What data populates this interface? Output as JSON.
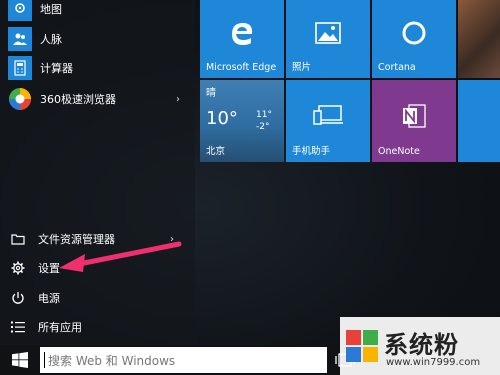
{
  "start_menu": {
    "apps": [
      {
        "label": "地图"
      },
      {
        "label": "人脉"
      },
      {
        "label": "计算器"
      },
      {
        "label": "360极速浏览器"
      }
    ],
    "bottom": [
      {
        "label": "文件资源管理器"
      },
      {
        "label": "设置"
      },
      {
        "label": "电源"
      },
      {
        "label": "所有应用"
      }
    ]
  },
  "tiles": {
    "edge": {
      "label": "Microsoft Edge"
    },
    "photos": {
      "label": "照片"
    },
    "cortana": {
      "label": "Cortana"
    },
    "weather": {
      "condition": "晴",
      "temp": "10°",
      "high": "11°",
      "low": "-2°",
      "city": "北京"
    },
    "phone": {
      "label": "手机助手"
    },
    "onenote": {
      "label": "OneNote"
    }
  },
  "taskbar": {
    "search_placeholder": "搜索 Web 和 Windows"
  },
  "watermark": {
    "text": "系统粉",
    "url": "www.win7999.com"
  },
  "colors": {
    "tile_blue": "#1e87d7",
    "onenote": "#7f3a8f",
    "weather_bg": "#2f6ea3",
    "annotation_arrow": "#f0306e"
  }
}
